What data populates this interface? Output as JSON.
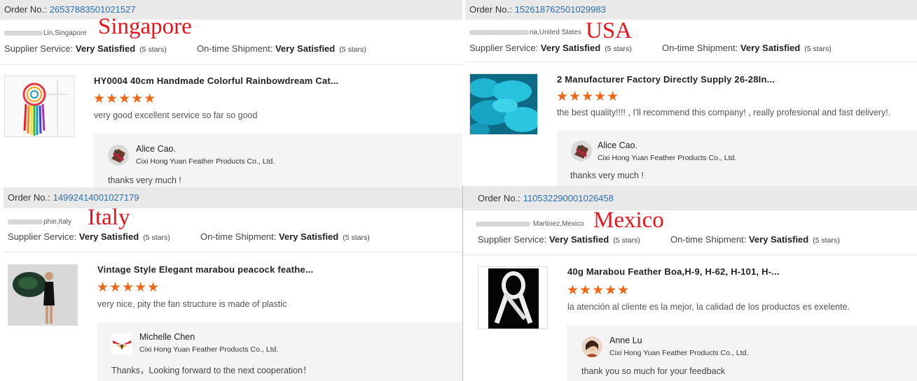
{
  "order_label": "Order No.:",
  "supplier_label": "Supplier Service:",
  "shipment_label": "On-time Shipment:",
  "colors": {
    "accent_link": "#2a6fb5",
    "star": "#ee6618",
    "annotation": "#e8141c"
  },
  "reviews": [
    {
      "order_no": "26537883501021527",
      "buyer": "Lin,Singapore",
      "country_annotation": "Singapore",
      "supplier_rating": "Very Satisfied",
      "supplier_stars": "(5 stars)",
      "shipment_rating": "Very Satisfied",
      "shipment_stars": "(5 stars)",
      "product_title": "HY0004 40cm Handmade Colorful Rainbowdream Cat...",
      "product_icon": "dreamcatcher-image",
      "stars": "★★★★★",
      "star_rating": 5,
      "review_text": "very good excellent service so far so good",
      "reply_name": "Alice Cao.",
      "reply_company": "Cixi Hong Yuan Feather Products Co., Ltd.",
      "reply_text": "thanks very much !"
    },
    {
      "order_no": "152618762501029983",
      "buyer": "na,United States",
      "country_annotation": "USA",
      "supplier_rating": "Very Satisfied",
      "supplier_stars": "(5 stars)",
      "shipment_rating": "Very Satisfied",
      "shipment_stars": "(5 stars)",
      "product_title": "2 Manufacturer Factory Directly Supply 26-28In...",
      "product_icon": "teal-feathers-image",
      "stars": "★★★★★",
      "star_rating": 5,
      "review_text": "the best quality!!!! , I'll recommend this company! , really profesional and fast delivery!.",
      "reply_name": "Alice Cao.",
      "reply_company": "Cixi Hong Yuan Feather Products Co., Ltd.",
      "reply_text": "thanks very much !"
    },
    {
      "order_no": "14992414001027179",
      "buyer": "phie,Italy",
      "country_annotation": "Italy",
      "supplier_rating": "Very Satisfied",
      "supplier_stars": "(5 stars)",
      "shipment_rating": "Very Satisfied",
      "shipment_stars": "(5 stars)",
      "product_title": "Vintage Style Elegant marabou peacock feathe...",
      "product_icon": "feather-fan-model-image",
      "stars": "★★★★★",
      "star_rating": 5,
      "review_text": "very nice, pity the fan structure is made of plastic",
      "reply_name": "Michelle Chen",
      "reply_company": "Cixi Hong Yuan Feather Products Co., Ltd.",
      "reply_text": "Thanks，Looking forward to the next cooperation！"
    },
    {
      "order_no": "110532290001026458",
      "buyer": "Martinez,Mexico",
      "country_annotation": "Mexico",
      "supplier_rating": "Very Satisfied",
      "supplier_stars": "(5 stars)",
      "shipment_rating": "Very Satisfied",
      "shipment_stars": "(5 stars)",
      "product_title": "40g Marabou Feather Boa,H-9, H-62, H-101, H-...",
      "product_icon": "white-boa-ribbon-image",
      "stars": "★★★★★",
      "star_rating": 5,
      "review_text": "la atención al cliente es la mejor, la calidad de los productos es exelente.",
      "reply_name": "Anne Lu",
      "reply_company": "Cixi Hong Yuan Feather Products Co., Ltd.",
      "reply_text": "thank you so much for your feedback"
    }
  ]
}
